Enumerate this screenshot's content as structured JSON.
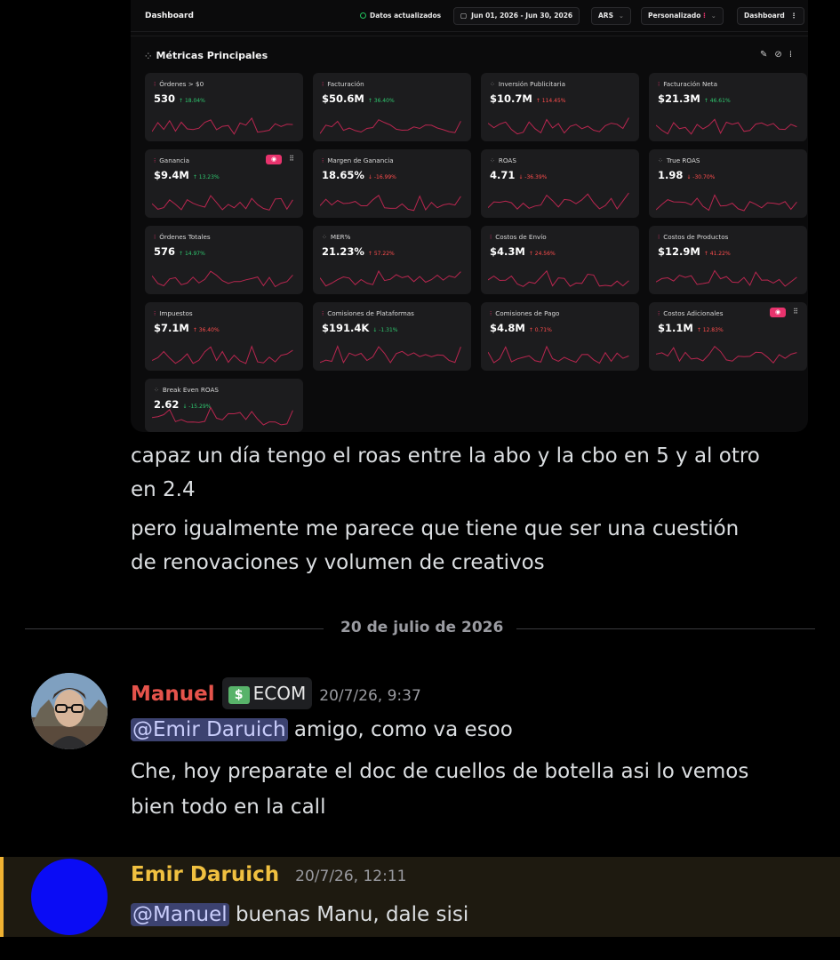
{
  "dashboard": {
    "title": "Dashboard",
    "status": "Datos actualizados",
    "date_range": "Jun 01, 2026 - Jun 30, 2026",
    "currency": "ARS",
    "custom": "Personalizado",
    "view": "Dashboard",
    "panel_title": "Métricas Principales",
    "cards": [
      {
        "label": "Órdenes > $0",
        "value": "530",
        "change": "↑ 18.04%",
        "trend": "up",
        "icon": "pink"
      },
      {
        "label": "Facturación",
        "value": "$50.6M",
        "change": "↑ 36.40%",
        "trend": "up",
        "icon": "pink"
      },
      {
        "label": "Inversión Publicitaria",
        "value": "$10.7M",
        "change": "↑ 114.45%",
        "trend": "upred",
        "icon": "gray"
      },
      {
        "label": "Facturación Neta",
        "value": "$21.3M",
        "change": "↑ 46.61%",
        "trend": "up",
        "icon": "pink"
      },
      {
        "label": "Ganancia",
        "value": "$9.4M",
        "change": "↑ 13.23%",
        "trend": "up",
        "icon": "pink"
      },
      {
        "label": "Margen de Ganancia",
        "value": "18.65%",
        "change": "↓ -16.99%",
        "trend": "down",
        "icon": "pink"
      },
      {
        "label": "ROAS",
        "value": "4.71",
        "change": "↓ -36.39%",
        "trend": "down",
        "icon": "gray"
      },
      {
        "label": "True ROAS",
        "value": "1.98",
        "change": "↓ -30.70%",
        "trend": "down",
        "icon": "gray"
      },
      {
        "label": "Órdenes Totales",
        "value": "576",
        "change": "↑ 14.97%",
        "trend": "up",
        "icon": "pink"
      },
      {
        "label": "MER%",
        "value": "21.23%",
        "change": "↑ 57.22%",
        "trend": "upred",
        "icon": "gray"
      },
      {
        "label": "Costos de Envío",
        "value": "$4.3M",
        "change": "↑ 24.56%",
        "trend": "upred",
        "icon": "pink"
      },
      {
        "label": "Costos de Productos",
        "value": "$12.9M",
        "change": "↑ 41.22%",
        "trend": "upred",
        "icon": "pink"
      },
      {
        "label": "Impuestos",
        "value": "$7.1M",
        "change": "↑ 36.40%",
        "trend": "upred",
        "icon": "pink"
      },
      {
        "label": "Comisiones de Plataformas",
        "value": "$191.4K",
        "change": "↓ -1.31%",
        "trend": "up",
        "icon": "pink"
      },
      {
        "label": "Comisiones de Pago",
        "value": "$4.8M",
        "change": "↑ 0.71%",
        "trend": "upred",
        "icon": "pink"
      },
      {
        "label": "Costos Adicionales",
        "value": "$1.1M",
        "change": "↑ 12.83%",
        "trend": "upred",
        "icon": "pink"
      },
      {
        "label": "Break Even ROAS",
        "value": "2.62",
        "change": "↓ -15.29%",
        "trend": "up",
        "icon": "gray"
      }
    ]
  },
  "chat": {
    "prev_line1": "capaz un día tengo el roas entre la abo y la cbo en 5 y al otro",
    "prev_line2": "en 2.4",
    "prev_line3": "pero igualmente me parece que tiene que ser una cuestión",
    "prev_line4": "de renovaciones y volumen de creativos",
    "date_divider": "20 de julio de 2026",
    "msg1": {
      "author": "Manuel",
      "author_color": "#e5534b",
      "badge": "ECOM",
      "timestamp": "20/7/26, 9:37",
      "mention": "@Emir Daruich",
      "text_after_mention": " amigo, como va esoo",
      "line2": "Che, hoy preparate el doc de cuellos de botella asi lo vemos",
      "line3": "bien todo en la call"
    },
    "msg2": {
      "author": "Emir Daruich",
      "author_color": "#f0c040",
      "timestamp": "20/7/26, 12:11",
      "mention": "@Manuel",
      "text_after_mention": " buenas Manu, dale sisi"
    }
  }
}
